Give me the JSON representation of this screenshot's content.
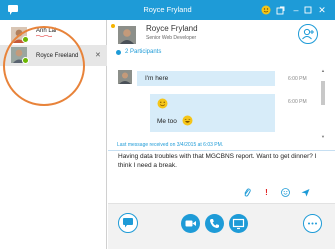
{
  "window": {
    "title": "Royce Fryland",
    "controls": {
      "minimize": "–",
      "close": "✕"
    }
  },
  "sidebar": {
    "contacts": [
      {
        "name": "Anh Lai",
        "status": "available",
        "selected": false
      },
      {
        "name": "Royce Freeland",
        "status": "available",
        "selected": true,
        "dismiss": "✕"
      }
    ],
    "highlight_color": "#e8833a"
  },
  "header": {
    "name": "Royce Fryland",
    "role": "Senior Web Developer",
    "participants": "2 Participants"
  },
  "conversation": {
    "messages": [
      {
        "sender": "Royce Fryland",
        "text": "I'm here",
        "time": "6:00 PM"
      },
      {
        "sender": "me",
        "emoticon": "smile",
        "time": "6:00 PM"
      },
      {
        "sender": "me",
        "text": "Me too",
        "emoticon": "laugh"
      }
    ],
    "last_received": "Last message received on 3/4/2015 at 6:03 PM."
  },
  "compose": {
    "draft": "Having data troubles with that MGCBNS report. Want to get dinner? I think I need a break.",
    "priority_mark": "!"
  },
  "actions": [
    "im",
    "video",
    "call",
    "share-screen",
    "more"
  ],
  "colors": {
    "accent": "#1e9bd7",
    "presence": "#6bb700",
    "bubble": "#d7ecf9",
    "priority": "#e02020"
  }
}
